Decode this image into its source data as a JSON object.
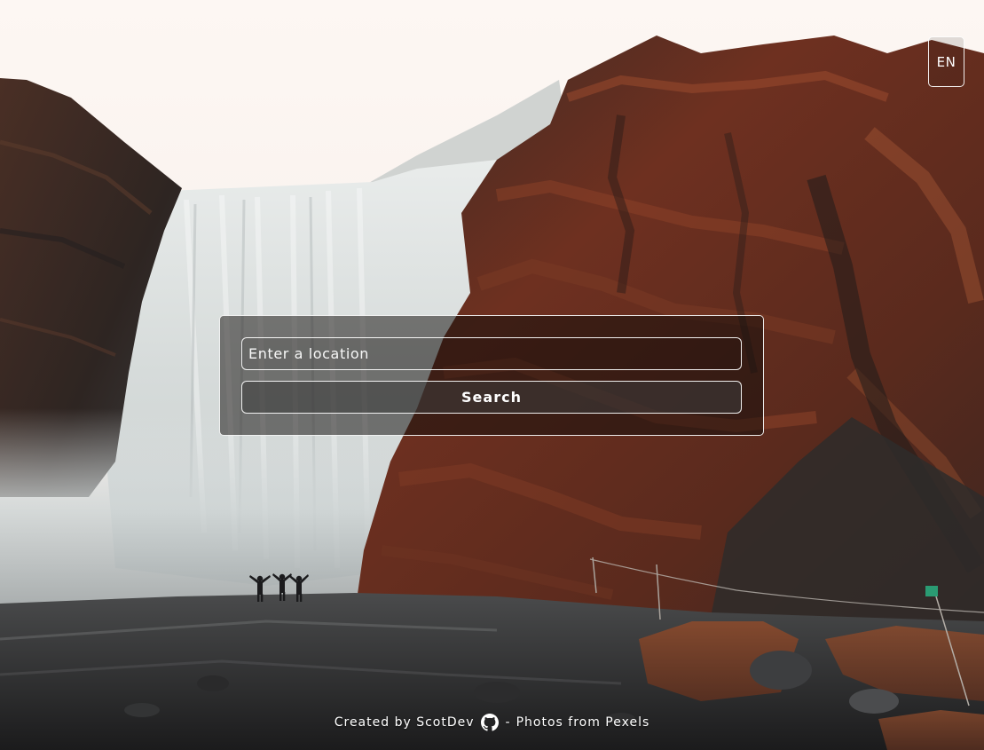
{
  "language_button": {
    "label": "EN"
  },
  "search": {
    "placeholder": "Enter a location",
    "value": "",
    "button_label": "Search"
  },
  "footer": {
    "created_by_text": "Created by",
    "author_link": "ScotDev",
    "icon": "github-icon",
    "separator": "-",
    "photos_link": "Photos from Pexels"
  },
  "colors": {
    "text": "#ffffff",
    "border": "#ffffff",
    "sky": "#fbf4f0",
    "rock": "#6b3222"
  }
}
